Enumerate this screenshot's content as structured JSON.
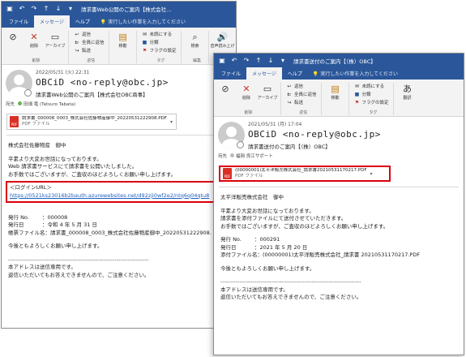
{
  "left": {
    "title": "請求書Web公開のご案内【株式会社…",
    "tabs": [
      "ファイル",
      "メッセージ",
      "ヘルプ"
    ],
    "active_tab": "メッセージ",
    "tell_me": "実行したい作業を入力してください",
    "ribbon": {
      "delete_group": {
        "label": "削除",
        "buttons": [
          "",
          "削除",
          "アーカイブ"
        ]
      },
      "respond_group": {
        "label": "返信",
        "buttons": [
          "返信",
          "全員に返信",
          "転送"
        ]
      },
      "move_group": {
        "label": "",
        "buttons": [
          "移動"
        ]
      },
      "tags_group": {
        "label": "タグ",
        "buttons": [
          "未読にする",
          "分類",
          "フラグの設定"
        ]
      },
      "editing_group": {
        "label": "編集",
        "buttons": [
          "検索"
        ]
      },
      "speech_group": {
        "label": "音声",
        "buttons": [
          "音声読み上げ"
        ]
      }
    },
    "message": {
      "date": "2022/05/31 (火) 22:31",
      "from": "OBCiD <no-reply@obc.jp>",
      "subject": "請求書Web公開のご案内【株式会社OBC商事】",
      "to_label": "宛先",
      "to_name": "田畑 竜 (Tatsuro Tabata)",
      "attachment_name": "請求書_000008_0003_株式会社佐藤物産御中_20220531222908.PDF",
      "attachment_type": "PDF ファイル",
      "body": {
        "greeting": "株式会社佐藤物産　御中",
        "line1": "平素より大変お世話になっております。",
        "line2": "Web 請求書サービスにて請求書を公開いたしました。",
        "line3": "お手数ではございますが、ご査収のほどよろしくお願い申し上げます。",
        "login_label": "＜ログインURL＞",
        "login_url": "https://0521ks23016b2bauth.azurewebsites.net/d92zji0wf2e2/ntq6q04qtu8",
        "issue_no_label": "発行 No.",
        "issue_no": "：000008",
        "issue_date_label": "発行日",
        "issue_date": "：令和 4 年 5 月 31 日",
        "file_label": "帳票ファイル名：",
        "file_name": "請求書_000008_0003_株式会社佐藤物産御中_20220531222908.",
        "closing": "今後ともよろしくお願い申し上げます。",
        "divider": "--------------------------------------------------------------------------",
        "footer1": "本アドレスは送信専用です。",
        "footer2": "返信いただいてもお答えできませんので、ご注意ください。"
      }
    }
  },
  "right": {
    "title": "請求書送付のご案内【（株）OBC】",
    "tabs": [
      "ファイル",
      "メッセージ",
      "ヘルプ"
    ],
    "active_tab": "メッセージ",
    "tell_me": "実行したい作業を入力してください",
    "ribbon": {
      "delete_group": {
        "label": "削除",
        "buttons": [
          "削除",
          "アーカイブ"
        ]
      },
      "respond_group": {
        "label": "返信",
        "buttons": [
          "返信",
          "全員に返信",
          "転送"
        ]
      },
      "move_group": {
        "label": "",
        "buttons": [
          "移動"
        ]
      },
      "tags_group": {
        "label": "タグ",
        "buttons": [
          "未読にする",
          "分類",
          "フラグの設定"
        ]
      },
      "editing_group": {
        "label": "",
        "buttons": [
          "翻訳"
        ]
      }
    },
    "message": {
      "date": "2021/05/31 (月) 17:04",
      "from": "OBCiD <no-reply@obc.jp>",
      "subject": "請求書送付のご案内【（株）OBC】",
      "to_label": "宛先",
      "to_name": "福岡 良江サポート",
      "attachment_name": "(00000001)太平洋販売株式会社_請求書20210531170217.PDF",
      "attachment_type": "PDF ファイル",
      "body": {
        "greeting": "太平洋販売株式会社　御中",
        "line1": "平素より大変お世話になっております。",
        "line2": "請求書を添付ファイルにて送付させていただきます。",
        "line3": "お手数ではございますが、ご査収のほどよろしくお願い申し上げます。",
        "issue_no_label": "発行 No.",
        "issue_no": "：000291",
        "issue_date_label": "発行日",
        "issue_date": "：2021 年 5 月 20 日",
        "file_label": "添付ファイル名：",
        "file_name": "(00000001)太平洋販売株式会社_請求書 20210531170217.PDF",
        "closing": "今後ともよろしくお願い申し上げます。",
        "divider": "--------------------------------------------------------------------------",
        "footer1": "本アドレスは送信専用です。",
        "footer2": "返信いただいてもお答えできませんので、ご注意ください。"
      }
    }
  },
  "colors": {
    "titlebar": "#2b579a",
    "highlight": "#d9000d",
    "link": "#1f5fbf",
    "pdf": "#d93025"
  },
  "icons": [
    "save-icon",
    "undo-icon",
    "redo-icon",
    "up-icon",
    "down-icon",
    "delete-icon",
    "archive-icon",
    "reply-icon",
    "reply-all-icon",
    "forward-icon",
    "move-icon",
    "mark-unread-icon",
    "categorize-icon",
    "flag-icon",
    "search-icon",
    "speech-icon",
    "translate-icon",
    "pdf-icon",
    "avatar-icon"
  ]
}
